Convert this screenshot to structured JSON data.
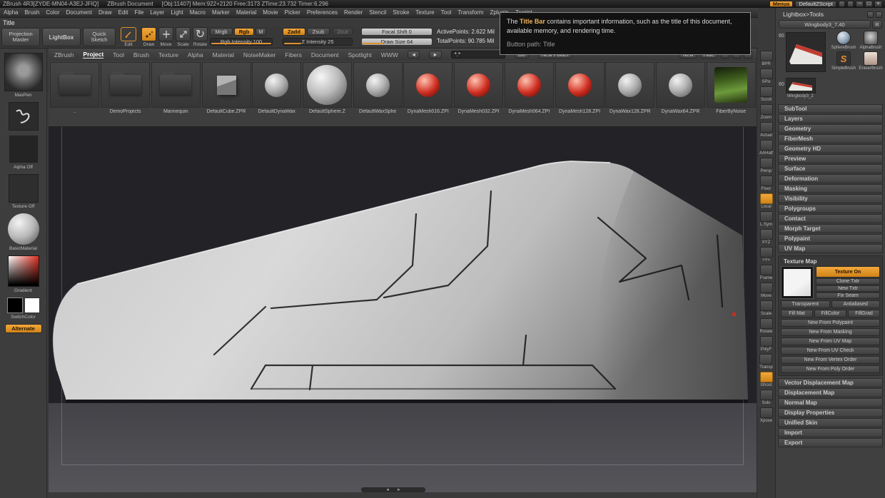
{
  "titlebar": {
    "app": "ZBrush 4R3[ZYDE-MN04-A3EJ-JFIQ]",
    "document": "ZBrush Document",
    "stats": "[Obj:11407]  Mem:922+2120  Free:3173  ZTime:23.732  Timer:6.296",
    "menus": "Menus",
    "zscript": "DefaultZScript",
    "window_controls": [
      "−",
      "□",
      "×"
    ]
  },
  "menubar": [
    "Alpha",
    "Brush",
    "Color",
    "Document",
    "Draw",
    "Edit",
    "File",
    "Layer",
    "Light",
    "Macro",
    "Marker",
    "Material",
    "Movie",
    "Picker",
    "Preferences",
    "Render",
    "Stencil",
    "Stroke",
    "Texture",
    "Tool",
    "Transform",
    "Zplugin",
    "Zscript"
  ],
  "title_label": "Title",
  "shelf": {
    "projection_master": "Projection Master",
    "lightbox": "LightBox",
    "quick_sketch": "Quick Sketch",
    "edit": "Edit",
    "draw": "Draw",
    "move": "Move",
    "scale": "Scale",
    "rotate": "Rotate",
    "mrgb": "Mrgb",
    "rgb": "Rgb",
    "m": "M",
    "rgb_intensity": "Rgb Intensity 100",
    "zadd": "Zadd",
    "zsub": "Zsub",
    "zcut": "Zcut",
    "z_intensity": "Z Intensity 25",
    "focal_shift": "Focal Shift 0",
    "draw_size": "Draw Size 64",
    "active_points": "ActivePoints: 2.622 Mil",
    "total_points": "TotalPoints: 90.785 Mil"
  },
  "tooltip": {
    "pre": "The ",
    "highlight": "Title Bar",
    "post": " contains important information, such as the title of this document, available memory, and rendering time.",
    "path": "Button path: Title"
  },
  "lightbox": {
    "tabs": [
      {
        "label": "ZBrush"
      },
      {
        "label": "Project",
        "active": true
      },
      {
        "label": "Tool"
      },
      {
        "label": "Brush"
      },
      {
        "label": "Texture"
      },
      {
        "label": "Alpha"
      },
      {
        "label": "Material"
      },
      {
        "label": "NoiseMaker"
      },
      {
        "label": "Fibers"
      },
      {
        "label": "Document"
      },
      {
        "label": "Spotlight"
      },
      {
        "label": "WWW"
      }
    ],
    "search_value": "*.*",
    "go": "Go",
    "new_folder": "New Folder",
    "new": "New",
    "hide": "Hide",
    "items": [
      {
        "label": "..",
        "type": "folder"
      },
      {
        "label": "DemoProjects",
        "type": "folder"
      },
      {
        "label": "Mannequin",
        "type": "folder"
      },
      {
        "label": "DefaultCube.ZPR",
        "type": "cube"
      },
      {
        "label": "DefaultDynaWax",
        "type": "graysphere"
      },
      {
        "label": "DefaultSphere.Z",
        "type": "bigsphere"
      },
      {
        "label": "DefaultWaxSphe",
        "type": "graysphere"
      },
      {
        "label": "DynaMesh016.ZPI",
        "type": "redsphere"
      },
      {
        "label": "DynaMesh032.ZPI",
        "type": "redsphere"
      },
      {
        "label": "DynaMesh064.ZPI",
        "type": "redsphere"
      },
      {
        "label": "DynaMesh128.ZPI",
        "type": "redsphere"
      },
      {
        "label": "DynaWax128.ZPR",
        "type": "graysphere"
      },
      {
        "label": "DynaWax64.ZPR",
        "type": "graysphere"
      },
      {
        "label": "FiberByNoise",
        "type": "grass"
      }
    ]
  },
  "left_panel": {
    "brush_label": "MaxPen",
    "alpha_label": "Alpha Off",
    "texture_label": "Texture Off",
    "material_label": "BasicMaterial",
    "gradient_label": "Gradient",
    "switch_label": "SwitchColor",
    "alternate_label": "Alternate"
  },
  "right_strip": {
    "items": [
      {
        "label": "BPR"
      },
      {
        "label": "SPix"
      },
      {
        "label": "Scroll"
      },
      {
        "label": "Zoom"
      },
      {
        "label": "Actual"
      },
      {
        "label": "AAHalf"
      },
      {
        "label": "Persp"
      },
      {
        "label": "Floor"
      },
      {
        "label": "Local",
        "active": true
      },
      {
        "label": "L.Sym"
      },
      {
        "label": "XYZ"
      },
      {
        "label": ">Y<"
      },
      {
        "label": "Frame"
      },
      {
        "label": "Move"
      },
      {
        "label": "Scale"
      },
      {
        "label": "Rotate"
      },
      {
        "label": "PolyF"
      },
      {
        "label": "Transp"
      },
      {
        "label": "Ghost",
        "active": true
      },
      {
        "label": "Solo"
      },
      {
        "label": "Xpose"
      }
    ]
  },
  "tool_panel": {
    "header": "Lightbox>Tools",
    "tool_name": "Wingbody3_7.40",
    "r_button": "R",
    "count_top": "60",
    "count_small": "60",
    "small_tool_label": "Wingbody3_2",
    "brushes": [
      {
        "label": "SphereBrush",
        "type": "sphere"
      },
      {
        "label": "AlphaBrush",
        "type": "alphabrush"
      },
      {
        "label": "SimpleBrush",
        "type": "simple"
      },
      {
        "label": "EraserBrush",
        "type": "eraser"
      }
    ],
    "sections_top": [
      "SubTool",
      "Layers",
      "Geometry",
      "FiberMesh",
      "Geometry HD",
      "Preview",
      "Surface",
      "Deformation",
      "Masking",
      "Visibility",
      "Polygroups",
      "Contact",
      "Morph Target",
      "Polypaint",
      "UV Map"
    ],
    "texture_map": {
      "title": "Texture Map",
      "texture_on": "Texture On",
      "side_buttons": [
        "Clone Txtr",
        "New Txtr",
        "Fix Seam"
      ],
      "row2": [
        "Transparent",
        "Antialiased"
      ],
      "row3": [
        "Fill Mat",
        "FillColor",
        "FillGrad"
      ],
      "new_from": [
        "New From Polypaint",
        "New From Masking",
        "New From UV Map",
        "New From UV Check",
        "New From Vertex Order",
        "New From Poly Order"
      ]
    },
    "sections_bottom": [
      "Vector Displacement Map",
      "Displacement Map",
      "Normal Map",
      "Display Properties",
      "Unified Skin",
      "Import",
      "Export"
    ]
  },
  "icons": {
    "nav_left": "◄",
    "nav_right": "►",
    "scroll_left": "◄",
    "scroll_right": "►",
    "rotate": "↻"
  }
}
